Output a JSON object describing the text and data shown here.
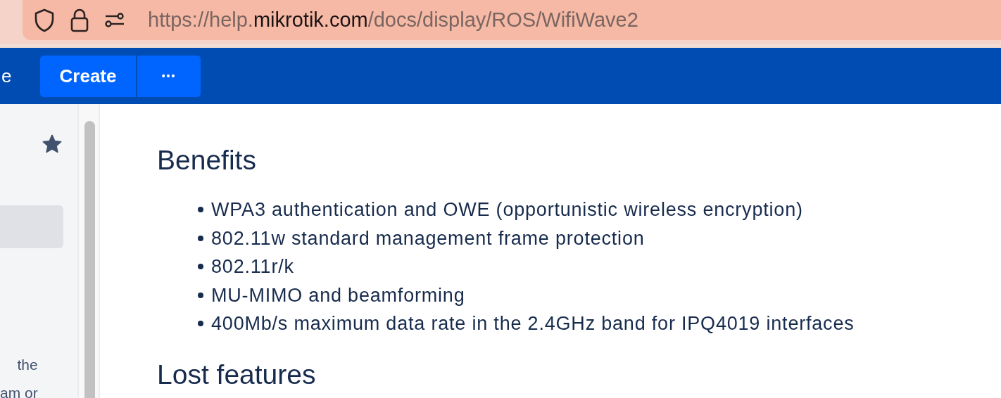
{
  "browser": {
    "url_prefix": "https://help.",
    "url_domain": "mikrotik.com",
    "url_path": "/docs/display/ROS/WifiWave2"
  },
  "header": {
    "nav_fragment": "e",
    "create_button": "Create",
    "more_button": "•••"
  },
  "sidebar": {
    "text_lines": [
      "the",
      "am or"
    ]
  },
  "content": {
    "heading": "Benefits",
    "items": [
      "WPA3 authentication and OWE (opportunistic wireless encryption)",
      "802.11w standard management frame protection",
      "802.11r/k",
      "MU-MIMO and beamforming",
      "400Mb/s maximum data rate in the 2.4GHz band for IPQ4019 interfaces"
    ],
    "next_heading": "Lost features"
  }
}
